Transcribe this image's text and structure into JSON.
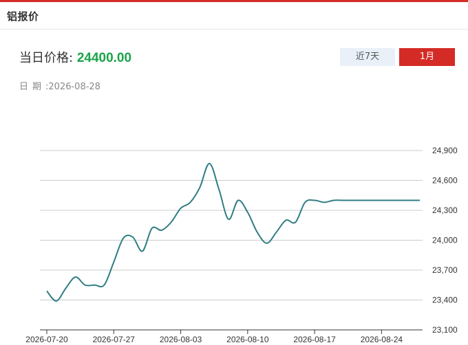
{
  "header": {
    "title": "铝报价"
  },
  "price": {
    "label": "当日价格",
    "separator": ":",
    "value": "24400.00",
    "value_color": "#1aa34a"
  },
  "date": {
    "label": "日期",
    "separator": ":",
    "value": "2026-08-28"
  },
  "range_buttons": {
    "week_label": "近7天",
    "month_label": "1月",
    "active": "1月",
    "active_color": "#d52b26"
  },
  "chart_data": {
    "type": "line",
    "title": "",
    "xlabel": "",
    "ylabel": "",
    "line_color": "#2e7d82",
    "grid": true,
    "y_axis_position": "right",
    "ylim": [
      23100,
      24900
    ],
    "yticks": [
      23100,
      23400,
      23700,
      24000,
      24300,
      24600,
      24900
    ],
    "ytick_labels": [
      "23,100",
      "23,400",
      "23,700",
      "24,000",
      "24,300",
      "24,600",
      "24,900"
    ],
    "xlim": [
      "2026-07-20",
      "2026-08-28"
    ],
    "xticks": [
      "2026-07-20",
      "2026-07-27",
      "2026-08-03",
      "2026-08-10",
      "2026-08-17",
      "2026-08-24"
    ],
    "series": [
      {
        "x": [
          "2026-07-20",
          "2026-07-21",
          "2026-07-22",
          "2026-07-23",
          "2026-07-24",
          "2026-07-25",
          "2026-07-26",
          "2026-07-27",
          "2026-07-28",
          "2026-07-29",
          "2026-07-30",
          "2026-07-31",
          "2026-08-01",
          "2026-08-02",
          "2026-08-03",
          "2026-08-04",
          "2026-08-05",
          "2026-08-06",
          "2026-08-07",
          "2026-08-08",
          "2026-08-09",
          "2026-08-10",
          "2026-08-11",
          "2026-08-12",
          "2026-08-13",
          "2026-08-14",
          "2026-08-15",
          "2026-08-16",
          "2026-08-17",
          "2026-08-18",
          "2026-08-19",
          "2026-08-20",
          "2026-08-21",
          "2026-08-22",
          "2026-08-23",
          "2026-08-24",
          "2026-08-25",
          "2026-08-26",
          "2026-08-27",
          "2026-08-28"
        ],
        "values": [
          23490,
          23390,
          23520,
          23630,
          23550,
          23550,
          23550,
          23780,
          24020,
          24030,
          23890,
          24120,
          24100,
          24180,
          24320,
          24380,
          24530,
          24770,
          24510,
          24210,
          24400,
          24280,
          24080,
          23970,
          24080,
          24200,
          24180,
          24380,
          24400,
          24380,
          24400,
          24400,
          24400,
          24400,
          24400,
          24400,
          24400,
          24400,
          24400,
          24400
        ]
      }
    ]
  }
}
